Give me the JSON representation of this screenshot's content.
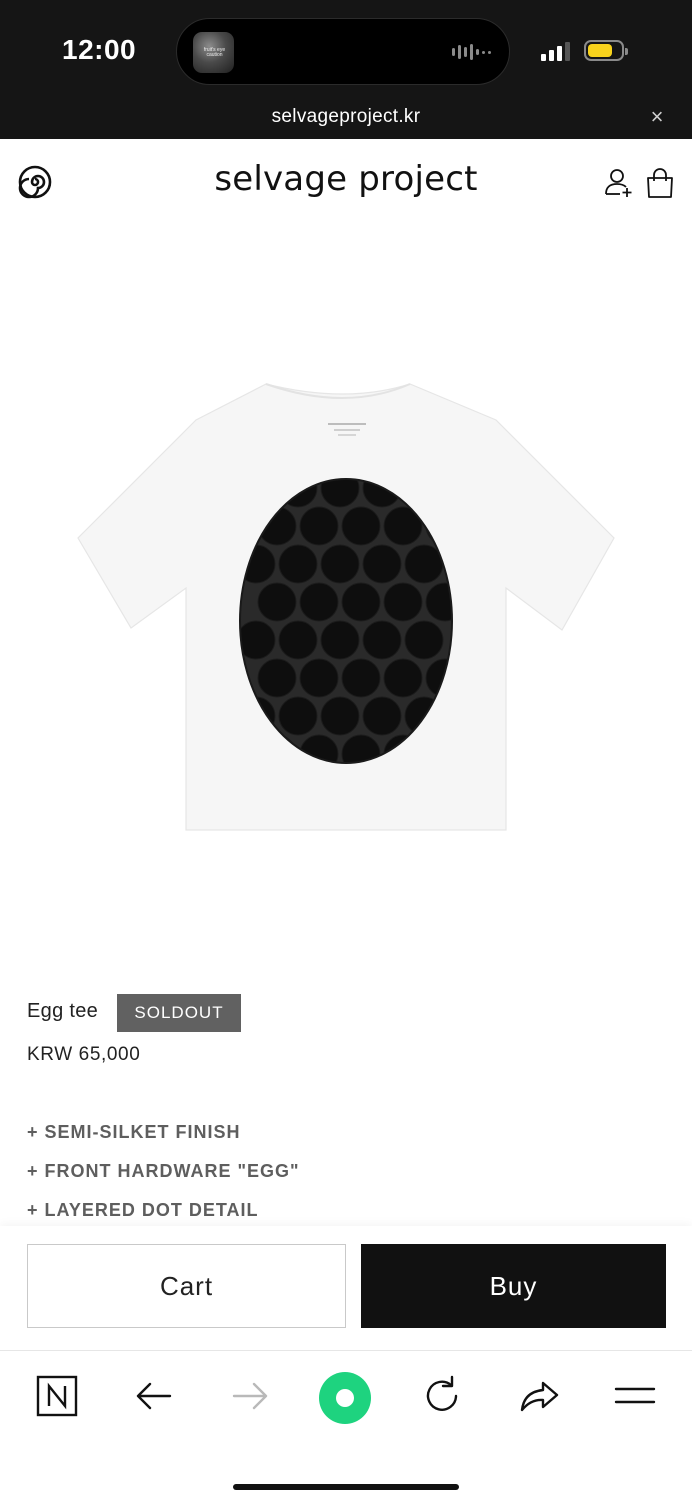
{
  "status_bar": {
    "time": "12:00",
    "now_playing_art_text": "fruit's eye caution",
    "battery_color": "#f7d21c"
  },
  "browser": {
    "url": "selvageproject.kr",
    "close_symbol": "×"
  },
  "site_header": {
    "brand": "selvage project",
    "logo_icon": "spiral-icon",
    "account_icon": "account-icon",
    "bag_icon": "shopping-bag-icon"
  },
  "product": {
    "name": "Egg tee",
    "status_badge": "SOLDOUT",
    "price": "KRW 65,000",
    "features": [
      "+ SEMI-SILKET FINISH",
      "+ FRONT HARDWARE \"EGG\"",
      "+ LAYERED DOT DETAIL"
    ],
    "image_alt": "white t-shirt with black egg-shaped dotted panel"
  },
  "actions": {
    "cart_label": "Cart",
    "buy_label": "Buy"
  },
  "toolbar": {
    "items": [
      "naver-home-icon",
      "back-arrow-icon",
      "forward-arrow-icon",
      "green-dot-icon",
      "reload-icon",
      "share-icon",
      "menu-icon"
    ],
    "accent_color": "#1ed37f"
  }
}
